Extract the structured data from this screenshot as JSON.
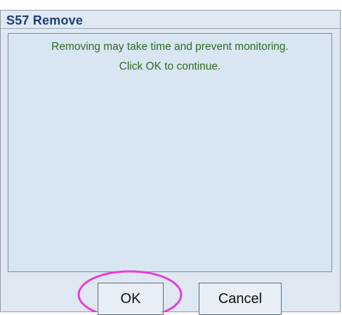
{
  "dialog": {
    "title": "S57 Remove",
    "message_line_1": "Removing may take time and prevent monitoring.",
    "message_line_2": "Click OK to continue."
  },
  "buttons": {
    "ok_label": "OK",
    "cancel_label": "Cancel"
  },
  "colors": {
    "dialog_background": "#dde8f2",
    "title_text": "#1f3f73",
    "message_text": "#2f6b1f",
    "annotation_highlight": "#e63fd6"
  }
}
